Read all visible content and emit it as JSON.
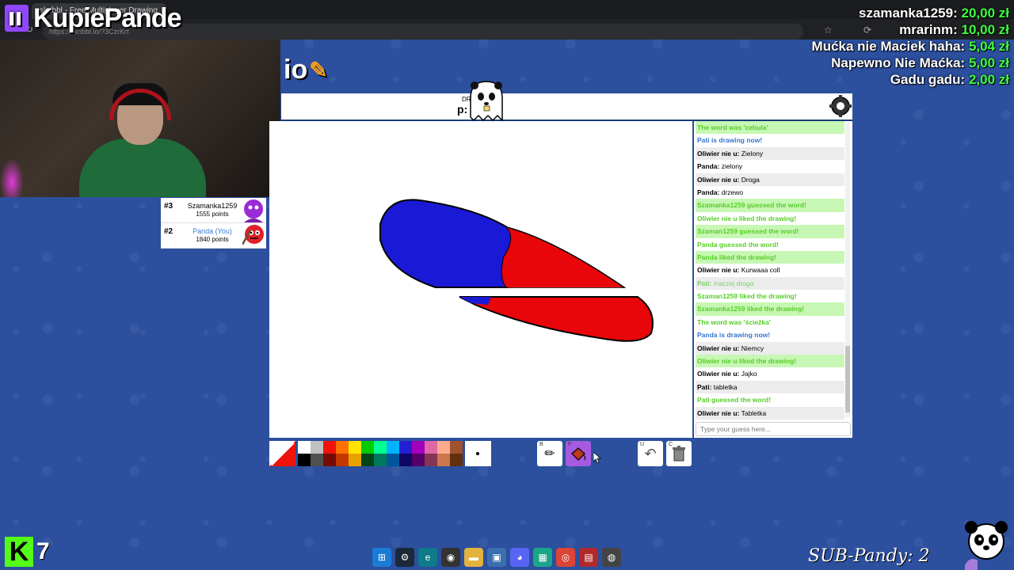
{
  "browser": {
    "tab_title": "skribbl - Free Multiplayer Drawing",
    "url": "https://skribbl.io/?3CzrKrf"
  },
  "overlay": {
    "channel_name": "KupiePande",
    "donations": [
      {
        "name": "szamanka1259:",
        "amount": "20,00 zł"
      },
      {
        "name": "mrarinm:",
        "amount": "10,00 zł"
      },
      {
        "name": "Mućka nie Maciek haha:",
        "amount": "5,04 zł"
      },
      {
        "name": "Napewno Nie Maćka:",
        "amount": "5,00 zł"
      },
      {
        "name": "Gadu gadu:",
        "amount": "2,00 zł"
      }
    ],
    "kick_logo": "K",
    "kick_count": "7",
    "sub_pandy": "SUB-Pandy: 2"
  },
  "game": {
    "logo_text": "io",
    "header_small": "DR",
    "header_word": "p:",
    "players": [
      {
        "rank": "#3",
        "name": "Szamanka1259",
        "points": "1555 points",
        "you": false,
        "avatar_color": "#9b2bd6"
      },
      {
        "rank": "#2",
        "name": "Panda (You)",
        "points": "1840 points",
        "you": true,
        "avatar_color": "#e0222a"
      }
    ],
    "chat": [
      {
        "type": "greenbg",
        "text": "The word was 'cebula'"
      },
      {
        "type": "blue",
        "text": "Pati is drawing now!"
      },
      {
        "type": "msg",
        "who": "Oliwier nie u:",
        "text": "Zielony",
        "alt": true
      },
      {
        "type": "msg",
        "who": "Panda:",
        "text": "zielony",
        "alt": false
      },
      {
        "type": "msg",
        "who": "Oliwier nie u:",
        "text": "Droga",
        "alt": true
      },
      {
        "type": "msg",
        "who": "Panda:",
        "text": "drzewo",
        "alt": false
      },
      {
        "type": "greenbg",
        "text": "Szamanka1259 guessed the word!"
      },
      {
        "type": "green",
        "text": "Oliwier nie u liked the drawing!"
      },
      {
        "type": "greenbg",
        "text": "Szaman1259 guessed the word!"
      },
      {
        "type": "green",
        "text": "Panda guessed the word!"
      },
      {
        "type": "greenbg",
        "text": "Panda liked the drawing!"
      },
      {
        "type": "msg",
        "who": "Oliwier nie u:",
        "text": "Kurwaaa coll",
        "alt": false
      },
      {
        "type": "faint",
        "who": "Pati:",
        "text": "inaczej droga"
      },
      {
        "type": "green",
        "text": "Szaman1259 liked the drawing!"
      },
      {
        "type": "greenbg",
        "text": "Szamanka1259 liked the drawing!"
      },
      {
        "type": "green",
        "text": "The word was 'ścieżka'"
      },
      {
        "type": "blue",
        "text": "Panda is drawing now!"
      },
      {
        "type": "msg",
        "who": "Oliwier nie u:",
        "text": "Niemcy",
        "alt": true
      },
      {
        "type": "greenbg",
        "text": "Oliwier nie u liked the drawing!"
      },
      {
        "type": "msg",
        "who": "Oliwier nie u:",
        "text": "Jajko",
        "alt": false
      },
      {
        "type": "msg",
        "who": "Pati:",
        "text": "tabletka",
        "alt": true
      },
      {
        "type": "green",
        "text": "Pati guessed the word!"
      },
      {
        "type": "msg",
        "who": "Oliwier nie u:",
        "text": "Tabletka",
        "alt": true
      }
    ],
    "chat_placeholder": "Type your guess here...",
    "palette": [
      "#ffffff",
      "#c1c1c1",
      "#ef130b",
      "#ff7100",
      "#ffe400",
      "#00cc00",
      "#00ff91",
      "#00b2ff",
      "#231fd3",
      "#a300ba",
      "#df69a7",
      "#ffac8e",
      "#a0522d",
      "#000000",
      "#505050",
      "#740b07",
      "#c23800",
      "#e8a200",
      "#004619",
      "#00785d",
      "#00569e",
      "#0e0865",
      "#550069",
      "#873554",
      "#cc774d",
      "#63300d"
    ],
    "tool_hotkeys": {
      "pen": "B",
      "fill": "F",
      "undo": "U",
      "clear": "C"
    }
  },
  "icons": {
    "settings": "gear-icon",
    "pen": "pencil-icon",
    "fill": "bucket-icon",
    "undo": "undo-icon",
    "clear": "trash-icon"
  },
  "colors": {
    "accent": "#a55ae0",
    "background": "#2c4f9e",
    "donation_amount": "#3fff3f"
  }
}
